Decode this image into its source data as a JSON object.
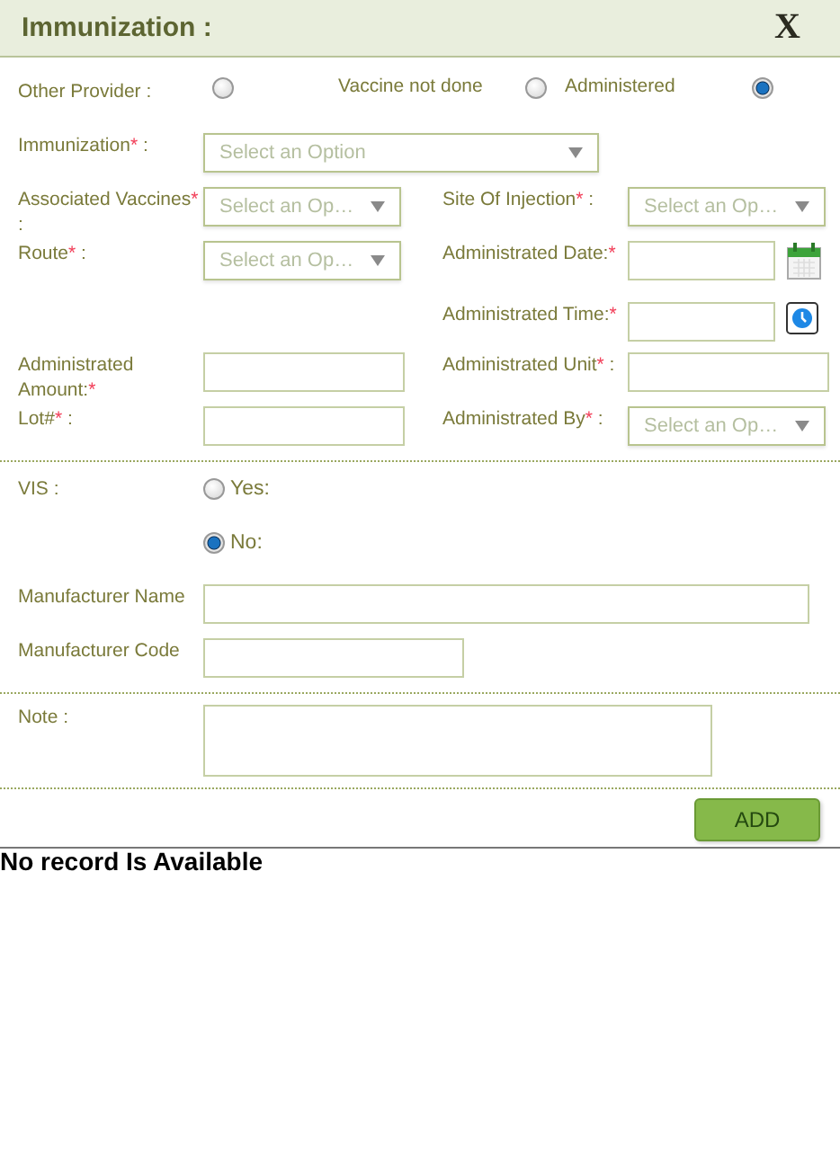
{
  "header": {
    "title": "Immunization :",
    "close": "X"
  },
  "status_options": [
    {
      "label": "Other Provider :",
      "selected": false
    },
    {
      "label": "Vaccine not done",
      "selected": false
    },
    {
      "label": "Administered",
      "selected": true
    }
  ],
  "fields": [
    {
      "left": {
        "label": "Immunization",
        "star": "*",
        "suffix": " :",
        "kind": "select-wide",
        "placeholder": "Select an Option"
      }
    },
    {
      "left": {
        "label": "Associated Vaccines",
        "star": "*",
        "suffix": " :",
        "kind": "select",
        "placeholder": "Select an Op…"
      },
      "right": {
        "label": "Site Of Injection",
        "star": "*",
        "suffix": " :",
        "kind": "select",
        "placeholder": "Select an Op…"
      }
    },
    {
      "left": {
        "label": "Route",
        "star": "*",
        "suffix": " :",
        "kind": "select",
        "placeholder": "Select an Op…"
      },
      "right": {
        "label": "Administrated Date:",
        "star": "*",
        "kind": "date"
      }
    },
    {
      "right": {
        "label": "Administrated Time:",
        "star": "*",
        "kind": "time"
      }
    },
    {
      "left": {
        "label": "Administrated Amount:",
        "star": "*",
        "kind": "text"
      },
      "right": {
        "label": "Administrated Unit",
        "star": "*",
        "suffix": " :",
        "kind": "text"
      }
    },
    {
      "left": {
        "label": "Lot#",
        "star": "*",
        "suffix": " :",
        "kind": "text"
      },
      "right": {
        "label": "Administrated By",
        "star": "*",
        "suffix": " :",
        "kind": "select",
        "placeholder": "Select an Op…"
      }
    }
  ],
  "vis": {
    "label": "VIS :",
    "options": [
      {
        "label": "Yes:",
        "selected": false
      },
      {
        "label": "No:",
        "selected": true
      }
    ]
  },
  "manufacturer": [
    {
      "label": "Manufacturer Name",
      "kind": "wide"
    },
    {
      "label": "Manufacturer Code",
      "kind": "short"
    }
  ],
  "note": {
    "label": "Note :"
  },
  "add_button": "ADD",
  "empty_message": "No record Is Available"
}
